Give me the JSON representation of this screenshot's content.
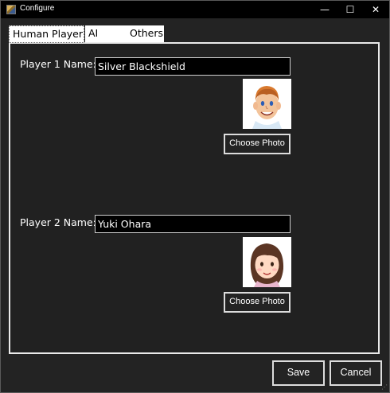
{
  "window": {
    "title": "Configure",
    "minimize": "—",
    "maximize": "☐",
    "close": "✕"
  },
  "tabs": [
    {
      "label": "Human Player",
      "selected": true
    },
    {
      "label": "AI",
      "selected": false
    },
    {
      "label": "Others",
      "selected": false
    }
  ],
  "players": [
    {
      "label": "Player 1 Name:",
      "value": "Silver Blackshield",
      "button": "Choose Photo",
      "avatar": "man-cartoon-avatar"
    },
    {
      "label": "Player 2 Name:",
      "value": "Yuki Ohara",
      "button": "Choose Photo",
      "avatar": "woman-cartoon-avatar"
    }
  ],
  "footer": {
    "save": "Save",
    "cancel": "Cancel"
  }
}
